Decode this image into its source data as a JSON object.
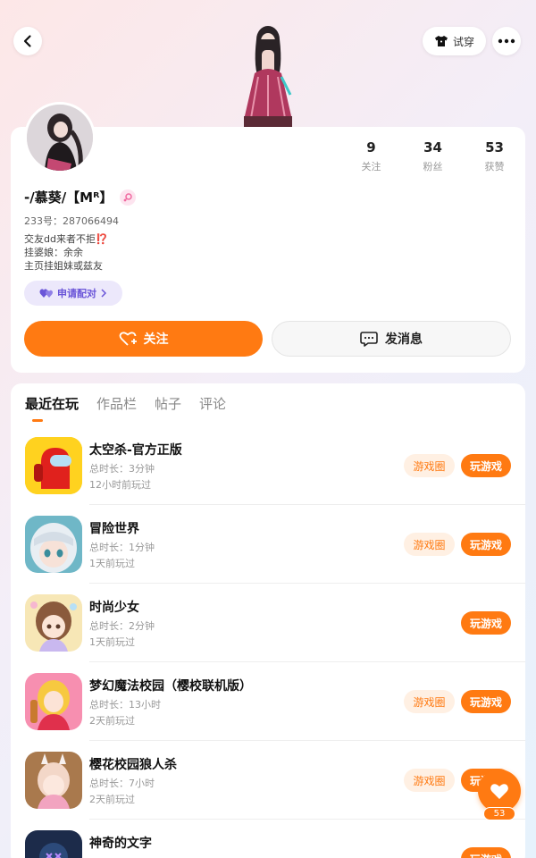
{
  "header": {
    "try_on_label": "试穿"
  },
  "profile": {
    "stats": [
      {
        "num": "9",
        "label": "关注"
      },
      {
        "num": "34",
        "label": "粉丝"
      },
      {
        "num": "53",
        "label": "获赞"
      }
    ],
    "nickname": "-/慕葵/【Mᴿ】",
    "uid": "233号：287066494",
    "bio_lines": [
      "交友dd来者不拒⁉️",
      "挂婆娘：余余",
      "主页挂姐妹或兹友"
    ],
    "pair_label": "申请配对",
    "follow_label": "关注",
    "message_label": "发消息"
  },
  "tabs": [
    "最近在玩",
    "作品栏",
    "帖子",
    "评论"
  ],
  "games": [
    {
      "title": "太空杀-官方正版",
      "duration": "总时长：3分钟",
      "played": "12小时前玩过",
      "circle": "游戏圈",
      "play": "玩游戏"
    },
    {
      "title": "冒险世界",
      "duration": "总时长：1分钟",
      "played": "1天前玩过",
      "circle": "游戏圈",
      "play": "玩游戏"
    },
    {
      "title": "时尚少女",
      "duration": "总时长：2分钟",
      "played": "1天前玩过",
      "circle": "",
      "play": "玩游戏"
    },
    {
      "title": "梦幻魔法校园（樱校联机版）",
      "duration": "总时长：13小时",
      "played": "2天前玩过",
      "circle": "游戏圈",
      "play": "玩游戏"
    },
    {
      "title": "樱花校园狼人杀",
      "duration": "总时长：7小时",
      "played": "2天前玩过",
      "circle": "游戏圈",
      "play": "玩游戏"
    },
    {
      "title": "神奇的文字",
      "duration": "",
      "played": "",
      "circle": "",
      "play": "玩游戏"
    }
  ],
  "like": {
    "count": "53"
  },
  "colors": {
    "accent": "#ff7a12",
    "pair_purple": "#6a55d8"
  }
}
